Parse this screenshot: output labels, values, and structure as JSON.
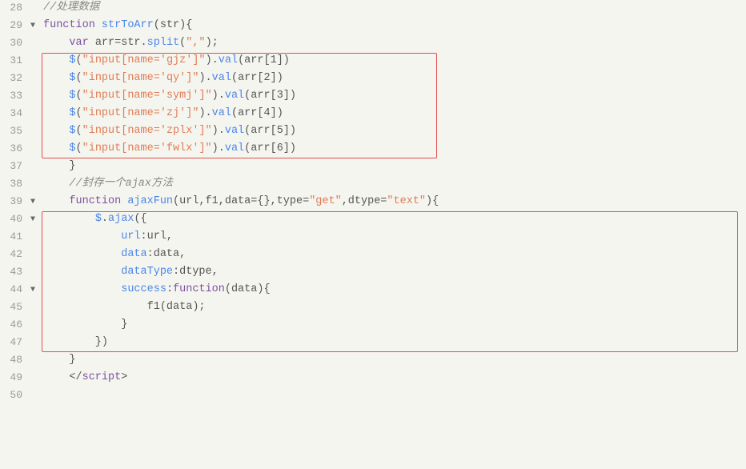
{
  "lines": [
    {
      "num": "28",
      "fold": "",
      "tokens": [
        {
          "type": "comment",
          "text": "//处理数据"
        }
      ]
    },
    {
      "num": "29",
      "fold": "▼",
      "tokens": [
        {
          "type": "kw",
          "text": "function"
        },
        {
          "type": "normal",
          "text": " "
        },
        {
          "type": "fn",
          "text": "strToArr"
        },
        {
          "type": "normal",
          "text": "("
        },
        {
          "type": "param",
          "text": "str"
        },
        {
          "type": "normal",
          "text": "){"
        }
      ]
    },
    {
      "num": "30",
      "fold": "",
      "tokens": [
        {
          "type": "normal",
          "text": "    "
        },
        {
          "type": "kw",
          "text": "var"
        },
        {
          "type": "normal",
          "text": " "
        },
        {
          "type": "normal",
          "text": "arr=str."
        },
        {
          "type": "method",
          "text": "split"
        },
        {
          "type": "normal",
          "text": "("
        },
        {
          "type": "str",
          "text": "\",\""
        },
        {
          "type": "normal",
          "text": ");"
        }
      ]
    },
    {
      "num": "31",
      "fold": "",
      "tokens": [
        {
          "type": "normal",
          "text": "    "
        },
        {
          "type": "dollar",
          "text": "$"
        },
        {
          "type": "normal",
          "text": "("
        },
        {
          "type": "str",
          "text": "\"input[name='gjz']\""
        },
        {
          "type": "normal",
          "text": ")."
        },
        {
          "type": "method",
          "text": "val"
        },
        {
          "type": "normal",
          "text": "(arr["
        },
        {
          "type": "normal",
          "text": "1"
        },
        {
          "type": "normal",
          "text": "])"
        }
      ]
    },
    {
      "num": "32",
      "fold": "",
      "tokens": [
        {
          "type": "normal",
          "text": "    "
        },
        {
          "type": "dollar",
          "text": "$"
        },
        {
          "type": "normal",
          "text": "("
        },
        {
          "type": "str",
          "text": "\"input[name='qy']\""
        },
        {
          "type": "normal",
          "text": ")."
        },
        {
          "type": "method",
          "text": "val"
        },
        {
          "type": "normal",
          "text": "(arr["
        },
        {
          "type": "normal",
          "text": "2"
        },
        {
          "type": "normal",
          "text": "])"
        }
      ]
    },
    {
      "num": "33",
      "fold": "",
      "tokens": [
        {
          "type": "normal",
          "text": "    "
        },
        {
          "type": "dollar",
          "text": "$"
        },
        {
          "type": "normal",
          "text": "("
        },
        {
          "type": "str",
          "text": "\"input[name='symj']\""
        },
        {
          "type": "normal",
          "text": ")."
        },
        {
          "type": "method",
          "text": "val"
        },
        {
          "type": "normal",
          "text": "(arr["
        },
        {
          "type": "normal",
          "text": "3"
        },
        {
          "type": "normal",
          "text": "])"
        }
      ]
    },
    {
      "num": "34",
      "fold": "",
      "tokens": [
        {
          "type": "normal",
          "text": "    "
        },
        {
          "type": "dollar",
          "text": "$"
        },
        {
          "type": "normal",
          "text": "("
        },
        {
          "type": "str",
          "text": "\"input[name='zj']\""
        },
        {
          "type": "normal",
          "text": ")."
        },
        {
          "type": "method",
          "text": "val"
        },
        {
          "type": "normal",
          "text": "(arr["
        },
        {
          "type": "normal",
          "text": "4"
        },
        {
          "type": "normal",
          "text": "])"
        }
      ]
    },
    {
      "num": "35",
      "fold": "",
      "tokens": [
        {
          "type": "normal",
          "text": "    "
        },
        {
          "type": "dollar",
          "text": "$"
        },
        {
          "type": "normal",
          "text": "("
        },
        {
          "type": "str",
          "text": "\"input[name='zplx']\""
        },
        {
          "type": "normal",
          "text": ")."
        },
        {
          "type": "method",
          "text": "val"
        },
        {
          "type": "normal",
          "text": "(arr["
        },
        {
          "type": "normal",
          "text": "5"
        },
        {
          "type": "normal",
          "text": "])"
        }
      ]
    },
    {
      "num": "36",
      "fold": "",
      "tokens": [
        {
          "type": "normal",
          "text": "    "
        },
        {
          "type": "dollar",
          "text": "$"
        },
        {
          "type": "normal",
          "text": "("
        },
        {
          "type": "str",
          "text": "\"input[name='fwlx']\""
        },
        {
          "type": "normal",
          "text": ")."
        },
        {
          "type": "method",
          "text": "val"
        },
        {
          "type": "normal",
          "text": "(arr["
        },
        {
          "type": "normal",
          "text": "6"
        },
        {
          "type": "normal",
          "text": "])"
        }
      ]
    },
    {
      "num": "37",
      "fold": "",
      "tokens": [
        {
          "type": "normal",
          "text": "    }"
        }
      ]
    },
    {
      "num": "38",
      "fold": "",
      "tokens": [
        {
          "type": "normal",
          "text": "    "
        },
        {
          "type": "comment",
          "text": "//封存一个ajax方法"
        }
      ]
    },
    {
      "num": "39",
      "fold": "▼",
      "tokens": [
        {
          "type": "normal",
          "text": "    "
        },
        {
          "type": "kw",
          "text": "function"
        },
        {
          "type": "normal",
          "text": " "
        },
        {
          "type": "fn",
          "text": "ajaxFun"
        },
        {
          "type": "normal",
          "text": "(url,f1,data="
        },
        {
          "type": "normal",
          "text": "{}"
        },
        {
          "type": "normal",
          "text": ",type="
        },
        {
          "type": "str",
          "text": "\"get\""
        },
        {
          "type": "normal",
          "text": ",dtype="
        },
        {
          "type": "str",
          "text": "\"text\""
        },
        {
          "type": "normal",
          "text": "){"
        }
      ]
    },
    {
      "num": "40",
      "fold": "▼",
      "tokens": [
        {
          "type": "normal",
          "text": "        "
        },
        {
          "type": "dollar",
          "text": "$"
        },
        {
          "type": "normal",
          "text": "."
        },
        {
          "type": "method",
          "text": "ajax"
        },
        {
          "type": "normal",
          "text": "({"
        }
      ]
    },
    {
      "num": "41",
      "fold": "",
      "tokens": [
        {
          "type": "normal",
          "text": "            "
        },
        {
          "type": "prop",
          "text": "url"
        },
        {
          "type": "normal",
          "text": ":url,"
        }
      ]
    },
    {
      "num": "42",
      "fold": "",
      "tokens": [
        {
          "type": "normal",
          "text": "            "
        },
        {
          "type": "prop",
          "text": "data"
        },
        {
          "type": "normal",
          "text": ":data,"
        }
      ]
    },
    {
      "num": "43",
      "fold": "",
      "tokens": [
        {
          "type": "normal",
          "text": "            "
        },
        {
          "type": "prop",
          "text": "dataType"
        },
        {
          "type": "normal",
          "text": ":dtype,"
        }
      ]
    },
    {
      "num": "44",
      "fold": "▼",
      "tokens": [
        {
          "type": "normal",
          "text": "            "
        },
        {
          "type": "prop",
          "text": "success"
        },
        {
          "type": "normal",
          "text": ":"
        },
        {
          "type": "kw",
          "text": "function"
        },
        {
          "type": "normal",
          "text": "(data){"
        }
      ]
    },
    {
      "num": "45",
      "fold": "",
      "tokens": [
        {
          "type": "normal",
          "text": "                f1(data);"
        }
      ]
    },
    {
      "num": "46",
      "fold": "",
      "tokens": [
        {
          "type": "normal",
          "text": "            }"
        }
      ]
    },
    {
      "num": "47",
      "fold": "",
      "tokens": [
        {
          "type": "normal",
          "text": "        })"
        }
      ]
    },
    {
      "num": "48",
      "fold": "",
      "tokens": [
        {
          "type": "normal",
          "text": "    }"
        }
      ]
    },
    {
      "num": "49",
      "fold": "",
      "tokens": [
        {
          "type": "normal",
          "text": "    "
        },
        {
          "type": "normal",
          "text": "</"
        },
        {
          "type": "kw",
          "text": "script"
        },
        {
          "type": "normal",
          "text": ">"
        }
      ]
    },
    {
      "num": "50",
      "fold": "",
      "tokens": []
    }
  ]
}
